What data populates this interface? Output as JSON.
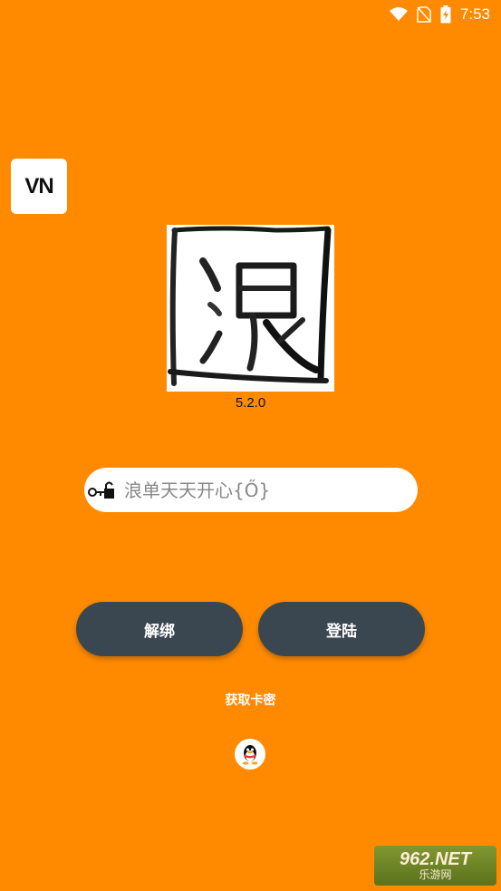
{
  "status_bar": {
    "time": "7:53",
    "icons": [
      "wifi-icon",
      "no-sim-icon",
      "battery-charging-icon"
    ]
  },
  "app_logo": {
    "text": "VN"
  },
  "app_image": {
    "character": "浪"
  },
  "version": "5.2.0",
  "card_input": {
    "placeholder": "浪单天天开心{Ő}",
    "value": "",
    "icon": "key-lock-icon"
  },
  "buttons": {
    "unbind_label": "解绑",
    "login_label": "登陆"
  },
  "get_card_label": "获取卡密",
  "qq_icon": "qq-penguin-icon",
  "watermark": {
    "top": "962.NET",
    "bottom": "乐游网"
  },
  "colors": {
    "background": "#FF8A00",
    "button": "#3A4750",
    "input": "#FFFFFF"
  }
}
